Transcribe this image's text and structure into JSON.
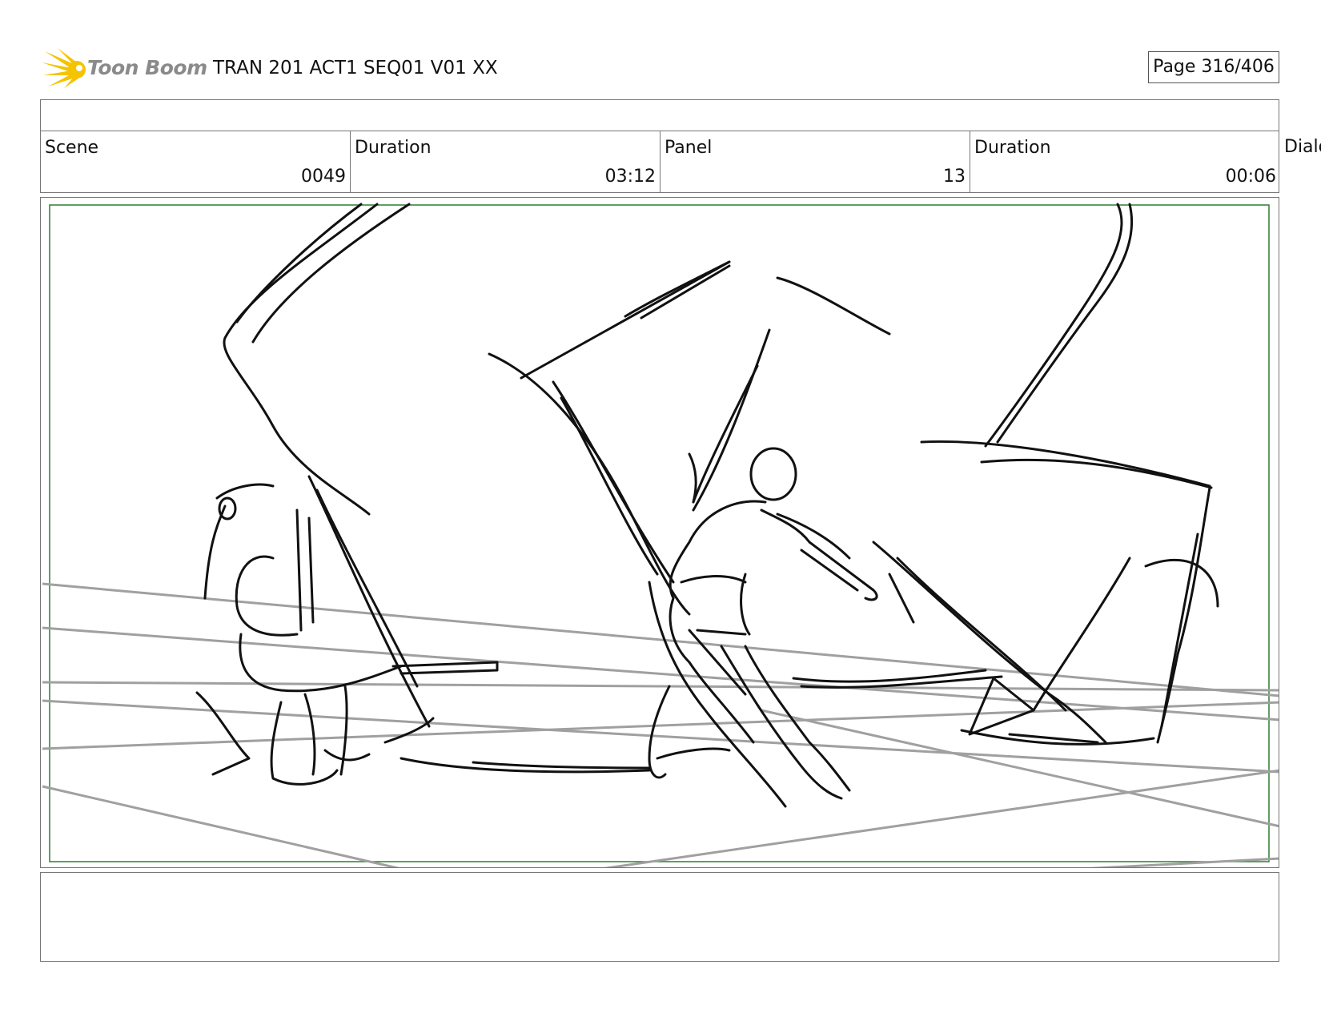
{
  "header": {
    "logo_text": "Toon Boom",
    "project_title": "TRAN 201 ACT1 SEQ01 V01 XX",
    "page_label": "Page 316/406"
  },
  "info": {
    "scene_label": "Scene",
    "scene_value": "0049",
    "scene_duration_label": "Duration",
    "scene_duration_value": "03:12",
    "panel_label": "Panel",
    "panel_value": "13",
    "panel_duration_label": "Duration",
    "panel_duration_value": "00:06",
    "dialog_label": "Dialo"
  },
  "colors": {
    "logo_yellow": "#f5c400",
    "safe_frame": "#2e7d32",
    "sketch_line": "#111111",
    "perspective_line": "#a0a0a0"
  },
  "icons": {
    "logo": "toon-boom-starburst-icon"
  }
}
